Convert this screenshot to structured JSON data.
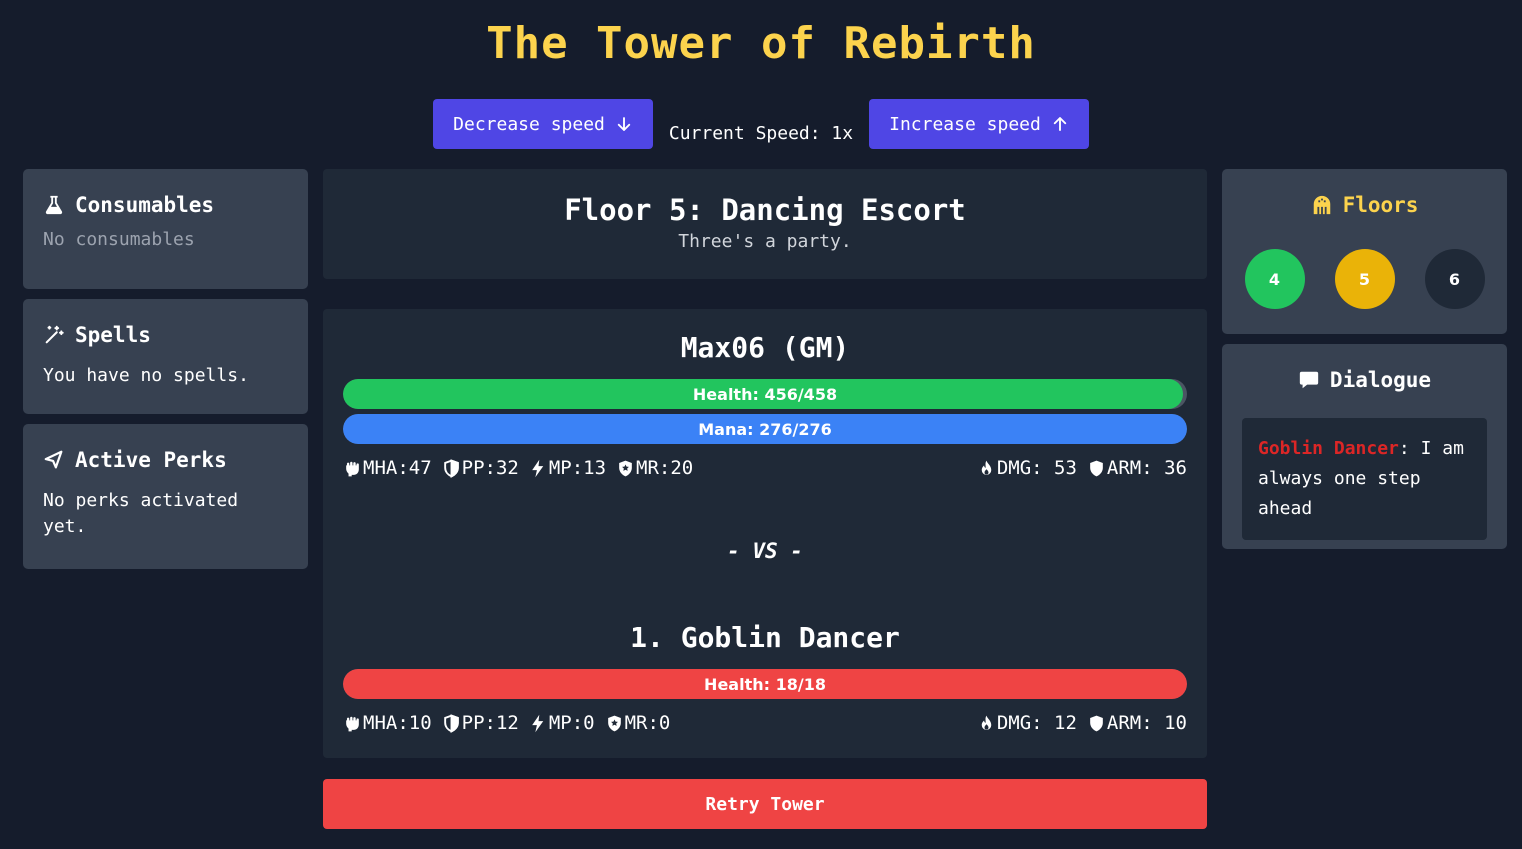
{
  "title": "The Tower of Rebirth",
  "speed": {
    "decrease_label": "Decrease speed",
    "current_label": "Current Speed: 1x",
    "increase_label": "Increase speed"
  },
  "consumables": {
    "title": "Consumables",
    "empty_text": "No consumables",
    "icon": "flask-icon"
  },
  "spells": {
    "title": "Spells",
    "empty_text": "You have no spells.",
    "icon": "magic-wand-icon"
  },
  "perks": {
    "title": "Active Perks",
    "empty_text": "No perks activated yet.",
    "icon": "flag-icon"
  },
  "floor": {
    "title": "Floor 5: Dancing Escort",
    "subtitle": "Three's a party."
  },
  "player": {
    "name": "Max06 (GM)",
    "health": {
      "label": "Health: 456/458",
      "current": 456,
      "max": 458
    },
    "mana": {
      "label": "Mana: 276/276",
      "current": 276,
      "max": 276
    },
    "stats": {
      "mha": "MHA:47",
      "pp": "PP:32",
      "mp": "MP:13",
      "mr": "MR:20",
      "dmg": "DMG: 53",
      "arm": "ARM: 36"
    }
  },
  "vs_text": "- VS -",
  "enemy": {
    "name": "1. Goblin Dancer",
    "health": {
      "label": "Health: 18/18",
      "current": 18,
      "max": 18
    },
    "stats": {
      "mha": "MHA:10",
      "pp": "PP:12",
      "mp": "MP:0",
      "mr": "MR:0",
      "dmg": "DMG: 12",
      "arm": "ARM: 10"
    }
  },
  "retry_label": "Retry Tower",
  "floors_panel": {
    "title": "Floors",
    "floors": [
      {
        "label": "4",
        "state": "cleared"
      },
      {
        "label": "5",
        "state": "current"
      },
      {
        "label": "6",
        "state": "locked"
      }
    ]
  },
  "dialogue": {
    "title": "Dialogue",
    "speaker": "Goblin Dancer",
    "separator": ":",
    "message": " I am always one step ahead"
  },
  "colors": {
    "background": "#151c2c",
    "panel": "#374151",
    "card": "#1f2937",
    "accent_indigo": "#4f46e5",
    "title_yellow": "#fcd34d",
    "health_green": "#22c55e",
    "mana_blue": "#3b82f6",
    "enemy_red": "#ef4444",
    "floor_current": "#eab308",
    "floor_locked": "#1f2937",
    "speaker_red": "#dc2626"
  }
}
